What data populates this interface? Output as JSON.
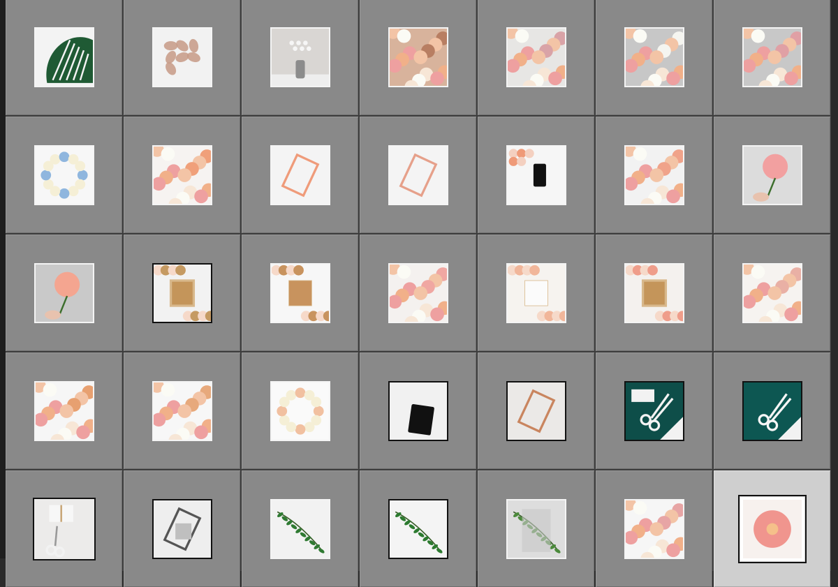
{
  "grid": {
    "columns": 7,
    "selected_index": 34,
    "colors": {
      "cell_bg": "#898989",
      "selected_cell_bg": "#cfcfcf",
      "gutter": "#3c3c3c"
    },
    "thumbnails": [
      {
        "name": "monstera-leaf",
        "bg": "#f3f3f3",
        "accent": "#1f5a34"
      },
      {
        "name": "succulent",
        "bg": "#f2f2f2",
        "accent": "#c79a86"
      },
      {
        "name": "vase-cotton",
        "bg": "#d9d6d3",
        "accent": "#8c8c8c"
      },
      {
        "name": "peach-roses-dense",
        "bg": "#d8b39c",
        "accent": "#b87e62"
      },
      {
        "name": "flower-shop",
        "bg": "#e7e6e4",
        "accent": "#d9a3a7"
      },
      {
        "name": "white-peonies",
        "bg": "#c7c7c7",
        "accent": "#f5f5f0"
      },
      {
        "name": "peony-grid",
        "bg": "#c8c8c8",
        "accent": "#e0a0a5"
      },
      {
        "name": "flower-wreath-blue",
        "bg": "#f7f7f7",
        "accent": "#8fb6de"
      },
      {
        "name": "rose-arrangement",
        "bg": "#f6f3f1",
        "accent": "#f0a07a"
      },
      {
        "name": "roses-clipboard",
        "bg": "#f4f4f4",
        "accent": "#ef9b7a"
      },
      {
        "name": "clipboard-flatlay",
        "bg": "#f4f4f4",
        "accent": "#e6a08a"
      },
      {
        "name": "phone-flatlay",
        "bg": "#f6f6f6",
        "accent": "#ef9a78"
      },
      {
        "name": "rose-cluster",
        "bg": "#f2f2f2",
        "accent": "#f0a38a"
      },
      {
        "name": "hand-rose",
        "bg": "#dcdcdc",
        "accent": "#f2a0a0"
      },
      {
        "name": "hand-rose-2",
        "bg": "#c9c9c9",
        "accent": "#f4a590"
      },
      {
        "name": "frame-flowers",
        "bg": "#f2f2f2",
        "accent": "#c59a62"
      },
      {
        "name": "card-flowers",
        "bg": "#f7f7f7",
        "accent": "#c8935e"
      },
      {
        "name": "flowers-spread",
        "bg": "#f4f1ef",
        "accent": "#f0a7a2"
      },
      {
        "name": "card-center",
        "bg": "#f6f3ef",
        "accent": "#f1b69a"
      },
      {
        "name": "card-frame",
        "bg": "#f4f1ee",
        "accent": "#ef9d8a"
      },
      {
        "name": "flowers-side",
        "bg": "#f6f3f0",
        "accent": "#e9b0a5"
      },
      {
        "name": "roses-corner",
        "bg": "#f6f6f6",
        "accent": "#e7a070"
      },
      {
        "name": "roses-edge",
        "bg": "#f7f7f7",
        "accent": "#e7a97c"
      },
      {
        "name": "white-wreath",
        "bg": "#fafafa",
        "accent": "#f1c0a0"
      },
      {
        "name": "phone-clips",
        "bg": "#f1f1f1",
        "accent": "#111111"
      },
      {
        "name": "rose-gold-clip",
        "bg": "#ebe9e7",
        "accent": "#c9855f"
      },
      {
        "name": "teal-scissors",
        "bg": "#0e4e49",
        "accent": "#f3f3f3"
      },
      {
        "name": "teal-scissors-2",
        "bg": "#0d5752",
        "accent": "#f6f6f6"
      },
      {
        "name": "scissors-gift",
        "bg": "#ecebea",
        "accent": "#c9a87a"
      },
      {
        "name": "card-clip-plant",
        "bg": "#eeeeee",
        "accent": "#555555"
      },
      {
        "name": "green-vine",
        "bg": "#f2f2f2",
        "accent": "#2f7a32"
      },
      {
        "name": "green-vine-2",
        "bg": "#f4f4f4",
        "accent": "#2c7a2f"
      },
      {
        "name": "green-sprig",
        "bg": "#dddddd",
        "accent": "#4b8a3b"
      },
      {
        "name": "flower-border",
        "bg": "#f6f6f6",
        "accent": "#e7a5a5"
      },
      {
        "name": "single-peony",
        "bg": "#f7f1ee",
        "accent": "#f0958e"
      }
    ]
  }
}
